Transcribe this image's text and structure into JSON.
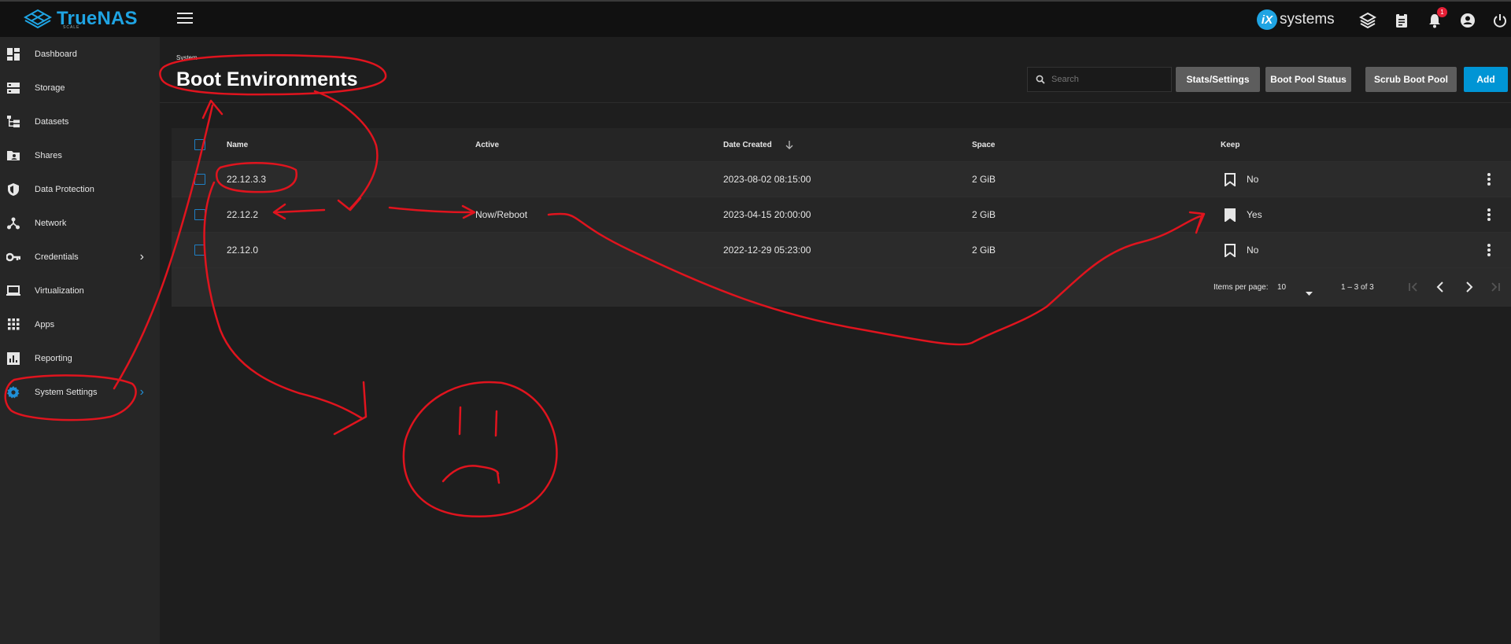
{
  "app": {
    "logo_text": "TrueNAS",
    "logo_sub": "SCALE",
    "vendor_badge": "iX",
    "vendor_text": "systems",
    "notification_count": "1"
  },
  "sidebar": {
    "items": [
      {
        "label": "Dashboard",
        "icon": "dashboard-icon"
      },
      {
        "label": "Storage",
        "icon": "storage-icon"
      },
      {
        "label": "Datasets",
        "icon": "datasets-icon"
      },
      {
        "label": "Shares",
        "icon": "shares-icon"
      },
      {
        "label": "Data Protection",
        "icon": "shield-icon"
      },
      {
        "label": "Network",
        "icon": "network-icon"
      },
      {
        "label": "Credentials",
        "icon": "key-icon",
        "has_submenu": true
      },
      {
        "label": "Virtualization",
        "icon": "laptop-icon"
      },
      {
        "label": "Apps",
        "icon": "apps-grid-icon"
      },
      {
        "label": "Reporting",
        "icon": "chart-icon"
      },
      {
        "label": "System Settings",
        "icon": "gear-icon",
        "has_submenu": true
      }
    ]
  },
  "page": {
    "breadcrumb": "System",
    "title": "Boot Environments",
    "search_placeholder": "Search",
    "buttons": {
      "stats": "Stats/Settings",
      "pool_status": "Boot Pool Status",
      "scrub": "Scrub Boot Pool",
      "add": "Add"
    }
  },
  "table": {
    "columns": {
      "name": "Name",
      "active": "Active",
      "date": "Date Created",
      "space": "Space",
      "keep": "Keep"
    },
    "rows": [
      {
        "name": "22.12.3.3",
        "active": "",
        "date": "2023-08-02 08:15:00",
        "space": "2 GiB",
        "keep": "No"
      },
      {
        "name": "22.12.2",
        "active": "Now/Reboot",
        "date": "2023-04-15 20:00:00",
        "space": "2 GiB",
        "keep": "Yes"
      },
      {
        "name": "22.12.0",
        "active": "",
        "date": "2022-12-29 05:23:00",
        "space": "2 GiB",
        "keep": "No"
      }
    ],
    "pagination": {
      "items_per_page_label": "Items per page:",
      "items_per_page": "10",
      "range": "1 – 3 of 3"
    }
  },
  "colors": {
    "accent": "#0095d5",
    "annotation": "#e0141e"
  }
}
